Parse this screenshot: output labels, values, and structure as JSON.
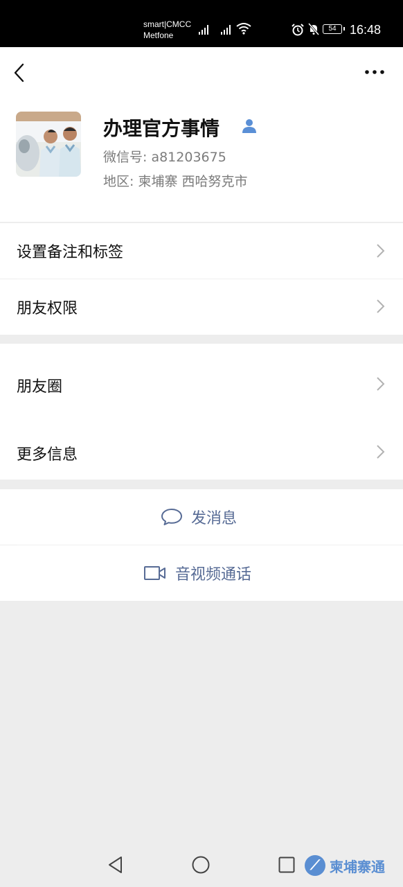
{
  "status_bar": {
    "carrier_line1": "smart|CMCC",
    "carrier_line2": "Metfone",
    "battery": "54",
    "time": "16:48",
    "icons": [
      "signal-icon",
      "signal-icon",
      "wifi-icon",
      "alarm-icon",
      "mute-icon",
      "battery-icon"
    ]
  },
  "top_nav": {
    "back_icon": "chevron-left-icon",
    "more_icon": "more-dots-icon"
  },
  "profile": {
    "name": "办理官方事情",
    "wechat_id": "微信号: a81203675",
    "region": "地区: 柬埔寨  西哈努克市",
    "verify_icon": "person-icon"
  },
  "menu": {
    "group1": [
      {
        "label": "设置备注和标签"
      },
      {
        "label": "朋友权限"
      }
    ],
    "group2": [
      {
        "label": "朋友圈"
      },
      {
        "label": "更多信息"
      }
    ]
  },
  "actions": {
    "send_message": "发消息",
    "video_call": "音视频通话"
  },
  "system_nav": {
    "icons": [
      "back-triangle-icon",
      "home-circle-icon",
      "recents-square-icon"
    ]
  },
  "watermark": {
    "text": "柬埔寨通"
  },
  "colors": {
    "link": "#576b95",
    "background": "#ededed",
    "status_bar": "#000000",
    "verify": "#5a8fd6"
  }
}
